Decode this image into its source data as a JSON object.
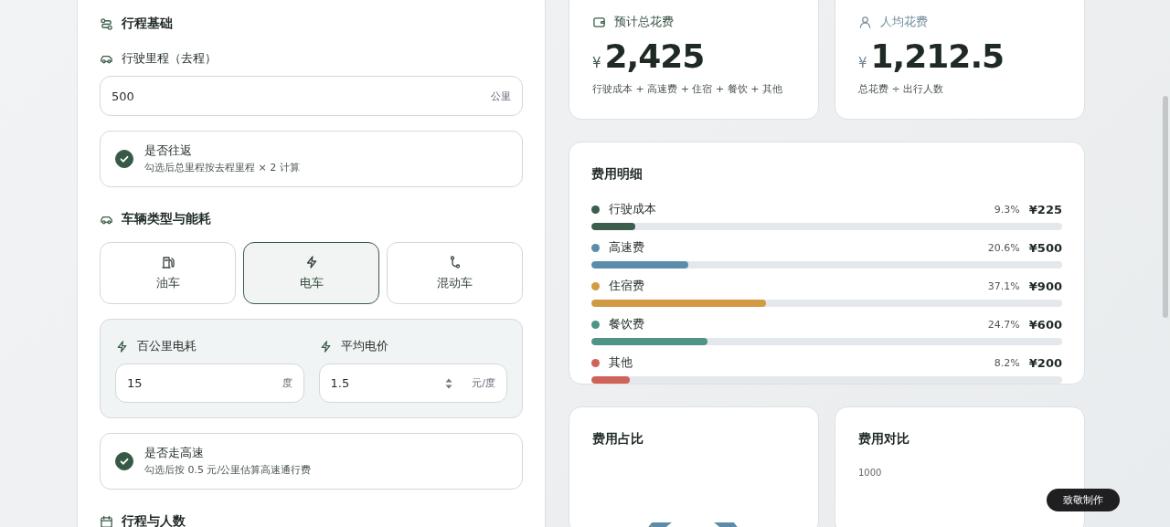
{
  "trip_panel": {
    "sections": [
      {
        "title": "行程基础"
      },
      {
        "title": "车辆类型与能耗"
      },
      {
        "title": "行程与人数"
      }
    ],
    "distance": {
      "label": "行驶里程（去程）",
      "value": "500",
      "unit": "公里"
    },
    "round_trip": {
      "title": "是否往返",
      "hint": "勾选后总里程按去程里程 × 2 计算",
      "checked": true
    },
    "vehicle_types": [
      {
        "kind": "fuel",
        "label": "油车",
        "selected": false
      },
      {
        "kind": "electric",
        "label": "电车",
        "selected": true
      },
      {
        "kind": "hybrid",
        "label": "混动车",
        "selected": false
      }
    ],
    "energy_fields": [
      {
        "label": "百公里电耗",
        "value": "15",
        "unit": "度",
        "spinner": false
      },
      {
        "label": "平均电价",
        "value": "1.5",
        "unit": "元/度",
        "spinner": true
      }
    ],
    "highway": {
      "title": "是否走高速",
      "hint": "勾选后按 0.5 元/公里估算高速通行费",
      "checked": true
    }
  },
  "stats": [
    {
      "label": "预计总花费",
      "currency": "¥",
      "amount": "2,425",
      "formula": "行驶成本 + 高速费 + 住宿 + 餐饮 + 其他"
    },
    {
      "label": "人均花费",
      "currency": "¥",
      "amount": "1,212.5",
      "formula": "总花费 ÷ 出行人数"
    }
  ],
  "breakdown": {
    "title": "费用明细",
    "items": [
      {
        "name": "行驶成本",
        "color": "#3d5e4c",
        "percent": "9.3%",
        "amount": "¥225",
        "level": 0.093
      },
      {
        "name": "高速费",
        "color": "#5b8cab",
        "percent": "20.6%",
        "amount": "¥500",
        "level": 0.206
      },
      {
        "name": "住宿费",
        "color": "#d29a42",
        "percent": "37.1%",
        "amount": "¥900",
        "level": 0.371
      },
      {
        "name": "餐饮费",
        "color": "#4f9484",
        "percent": "24.7%",
        "amount": "¥600",
        "level": 0.247
      },
      {
        "name": "其他",
        "color": "#cf6357",
        "percent": "8.2%",
        "amount": "¥200",
        "level": 0.082
      }
    ]
  },
  "share_card": {
    "title": "费用占比"
  },
  "compare_card": {
    "title": "费用对比",
    "axis_label": "1000"
  },
  "badge": {
    "label": "致敬制作"
  }
}
